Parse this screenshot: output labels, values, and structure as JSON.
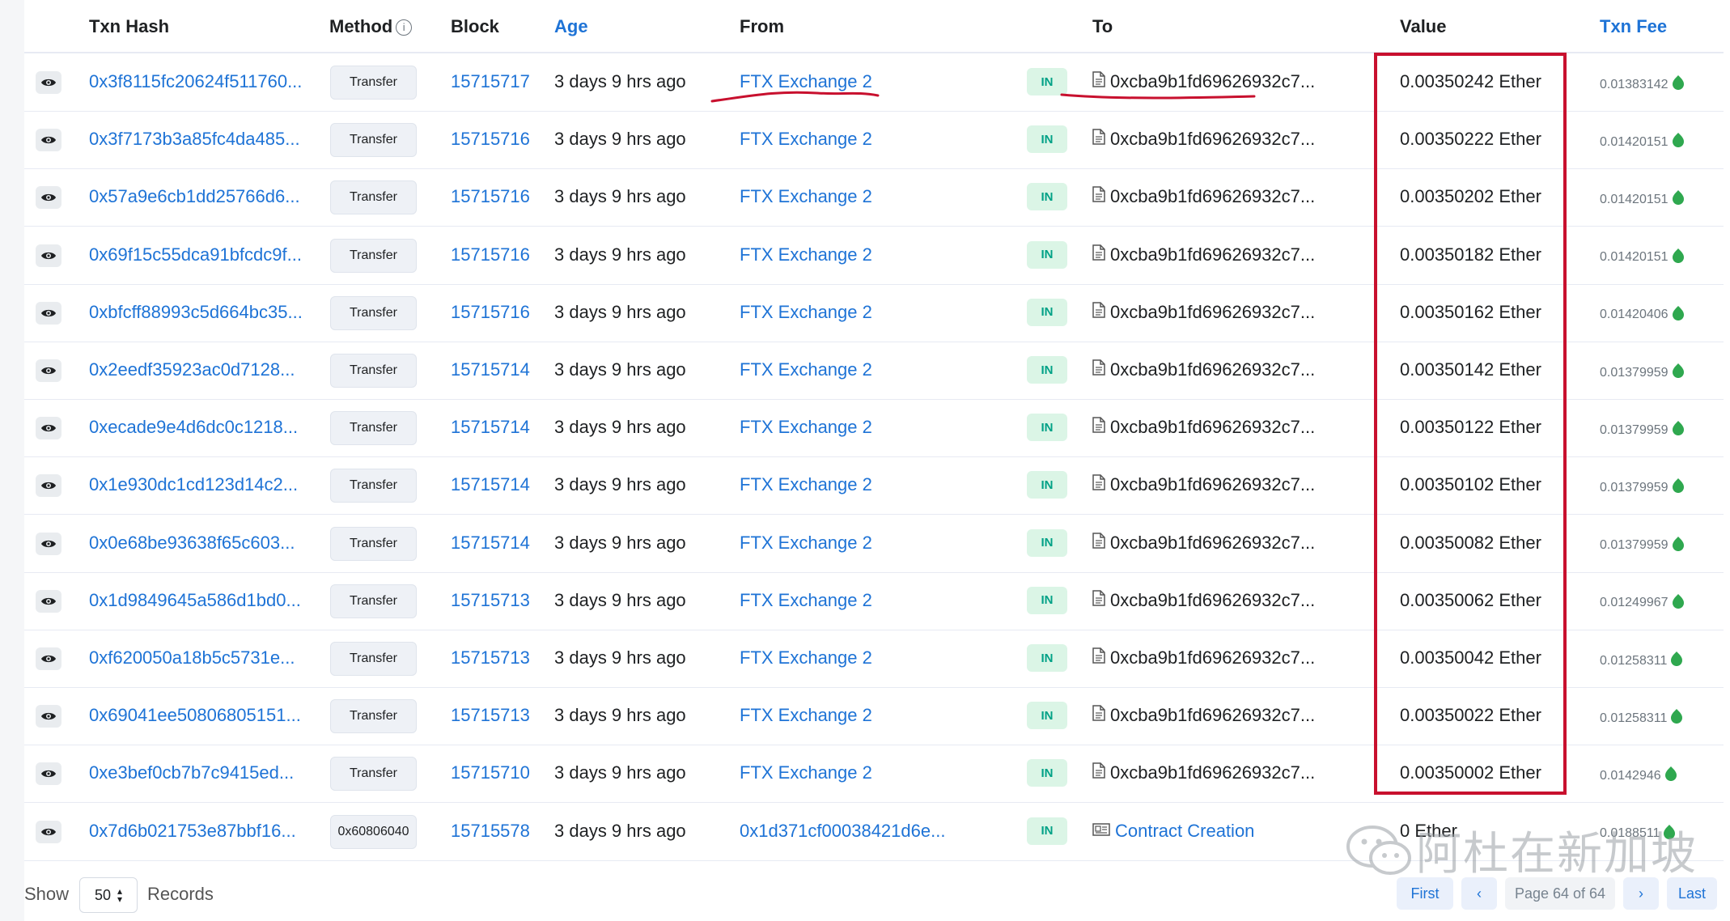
{
  "headers": {
    "txn_hash": "Txn Hash",
    "method": "Method",
    "block": "Block",
    "age": "Age",
    "from": "From",
    "to": "To",
    "value": "Value",
    "txn_fee": "Txn Fee"
  },
  "rows": [
    {
      "hash": "0x3f8115fc20624f511760...",
      "method": "Transfer",
      "block": "15715717",
      "age": "3 days 9 hrs ago",
      "from": "FTX Exchange 2",
      "dir": "IN",
      "to": "0xcba9b1fd69626932c7...",
      "value": "0.00350242 Ether",
      "fee": "0.01383142"
    },
    {
      "hash": "0x3f7173b3a85fc4da485...",
      "method": "Transfer",
      "block": "15715716",
      "age": "3 days 9 hrs ago",
      "from": "FTX Exchange 2",
      "dir": "IN",
      "to": "0xcba9b1fd69626932c7...",
      "value": "0.00350222 Ether",
      "fee": "0.01420151"
    },
    {
      "hash": "0x57a9e6cb1dd25766d6...",
      "method": "Transfer",
      "block": "15715716",
      "age": "3 days 9 hrs ago",
      "from": "FTX Exchange 2",
      "dir": "IN",
      "to": "0xcba9b1fd69626932c7...",
      "value": "0.00350202 Ether",
      "fee": "0.01420151"
    },
    {
      "hash": "0x69f15c55dca91bfcdc9f...",
      "method": "Transfer",
      "block": "15715716",
      "age": "3 days 9 hrs ago",
      "from": "FTX Exchange 2",
      "dir": "IN",
      "to": "0xcba9b1fd69626932c7...",
      "value": "0.00350182 Ether",
      "fee": "0.01420151"
    },
    {
      "hash": "0xbfcff88993c5d664bc35...",
      "method": "Transfer",
      "block": "15715716",
      "age": "3 days 9 hrs ago",
      "from": "FTX Exchange 2",
      "dir": "IN",
      "to": "0xcba9b1fd69626932c7...",
      "value": "0.00350162 Ether",
      "fee": "0.01420406"
    },
    {
      "hash": "0x2eedf35923ac0d7128...",
      "method": "Transfer",
      "block": "15715714",
      "age": "3 days 9 hrs ago",
      "from": "FTX Exchange 2",
      "dir": "IN",
      "to": "0xcba9b1fd69626932c7...",
      "value": "0.00350142 Ether",
      "fee": "0.01379959"
    },
    {
      "hash": "0xecade9e4d6dc0c1218...",
      "method": "Transfer",
      "block": "15715714",
      "age": "3 days 9 hrs ago",
      "from": "FTX Exchange 2",
      "dir": "IN",
      "to": "0xcba9b1fd69626932c7...",
      "value": "0.00350122 Ether",
      "fee": "0.01379959"
    },
    {
      "hash": "0x1e930dc1cd123d14c2...",
      "method": "Transfer",
      "block": "15715714",
      "age": "3 days 9 hrs ago",
      "from": "FTX Exchange 2",
      "dir": "IN",
      "to": "0xcba9b1fd69626932c7...",
      "value": "0.00350102 Ether",
      "fee": "0.01379959"
    },
    {
      "hash": "0x0e68be93638f65c603...",
      "method": "Transfer",
      "block": "15715714",
      "age": "3 days 9 hrs ago",
      "from": "FTX Exchange 2",
      "dir": "IN",
      "to": "0xcba9b1fd69626932c7...",
      "value": "0.00350082 Ether",
      "fee": "0.01379959"
    },
    {
      "hash": "0x1d9849645a586d1bd0...",
      "method": "Transfer",
      "block": "15715713",
      "age": "3 days 9 hrs ago",
      "from": "FTX Exchange 2",
      "dir": "IN",
      "to": "0xcba9b1fd69626932c7...",
      "value": "0.00350062 Ether",
      "fee": "0.01249967"
    },
    {
      "hash": "0xf620050a18b5c5731e...",
      "method": "Transfer",
      "block": "15715713",
      "age": "3 days 9 hrs ago",
      "from": "FTX Exchange 2",
      "dir": "IN",
      "to": "0xcba9b1fd69626932c7...",
      "value": "0.00350042 Ether",
      "fee": "0.01258311"
    },
    {
      "hash": "0x69041ee50806805151...",
      "method": "Transfer",
      "block": "15715713",
      "age": "3 days 9 hrs ago",
      "from": "FTX Exchange 2",
      "dir": "IN",
      "to": "0xcba9b1fd69626932c7...",
      "value": "0.00350022 Ether",
      "fee": "0.01258311"
    },
    {
      "hash": "0xe3bef0cb7b7c9415ed...",
      "method": "Transfer",
      "block": "15715710",
      "age": "3 days 9 hrs ago",
      "from": "FTX Exchange 2",
      "dir": "IN",
      "to": "0xcba9b1fd69626932c7...",
      "value": "0.00350002 Ether",
      "fee": "0.0142946"
    },
    {
      "hash": "0x7d6b021753e87bbf16...",
      "method": "0x60806040",
      "block": "15715578",
      "age": "3 days 9 hrs ago",
      "from": "0x1d371cf00038421d6e...",
      "dir": "IN",
      "to": "Contract Creation",
      "value": "0 Ether",
      "fee": "0.0188511"
    }
  ],
  "footer": {
    "show": "Show",
    "records_value": "50",
    "records": "Records",
    "first": "First",
    "prev": "‹",
    "page": "Page 64 of 64",
    "next": "›",
    "last": "Last"
  },
  "watermark": "阿杜在新加坡",
  "colors": {
    "link": "#1e73d6",
    "annotation_red": "#c8102e",
    "in_badge_bg": "#dbf5e6",
    "in_badge_text": "#00a186"
  }
}
